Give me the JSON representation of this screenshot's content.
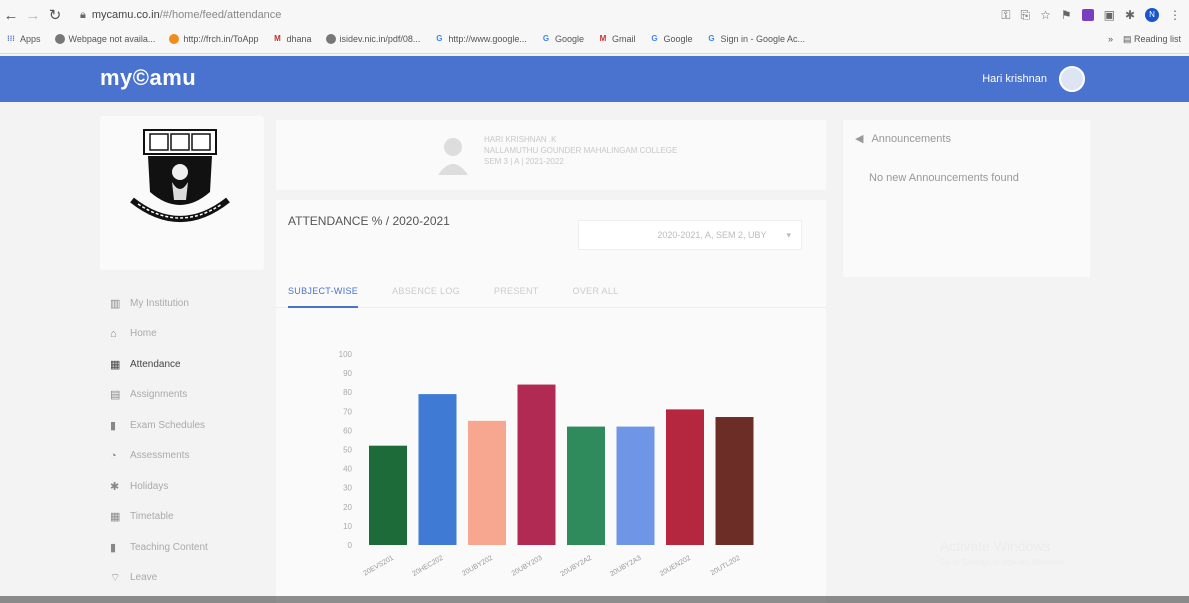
{
  "browser": {
    "url_host": "mycamu.co.in",
    "url_path": "/#/home/feed/attendance",
    "bookmarks": [
      {
        "label": "Apps",
        "icon": "apps-grid-icon"
      },
      {
        "label": "Webpage not availa...",
        "icon": "globe-icon"
      },
      {
        "label": "http://frch.in/ToApp",
        "icon": "orange-circle-icon"
      },
      {
        "label": "dhana",
        "icon": "gmail-icon"
      },
      {
        "label": "isidev.nic.in/pdf/08...",
        "icon": "globe-icon"
      },
      {
        "label": "http://www.google...",
        "icon": "google-icon"
      },
      {
        "label": "Google",
        "icon": "google-icon"
      },
      {
        "label": "Gmail",
        "icon": "gmail-icon"
      },
      {
        "label": "Google",
        "icon": "google-icon"
      },
      {
        "label": "Sign in - Google Ac...",
        "icon": "google-icon"
      }
    ],
    "more_bookmarks": "»",
    "reading_list": "Reading list",
    "profile_initial": "N"
  },
  "header": {
    "logo": "my©amu",
    "user_name": "Hari krishnan"
  },
  "sidebar": {
    "items": [
      {
        "label": "My Institution",
        "icon": "institution-icon",
        "glyph": "▥"
      },
      {
        "label": "Home",
        "icon": "home-icon",
        "glyph": "⌂"
      },
      {
        "label": "Attendance",
        "icon": "attendance-icon",
        "glyph": "▦",
        "active": true
      },
      {
        "label": "Assignments",
        "icon": "assignments-icon",
        "glyph": "▤"
      },
      {
        "label": "Exam Schedules",
        "icon": "exam-icon",
        "glyph": "▮"
      },
      {
        "label": "Assessments",
        "icon": "assessment-icon",
        "glyph": "◔"
      },
      {
        "label": "Holidays",
        "icon": "holiday-icon",
        "glyph": "✱"
      },
      {
        "label": "Timetable",
        "icon": "timetable-icon",
        "glyph": "▦"
      },
      {
        "label": "Teaching Content",
        "icon": "content-icon",
        "glyph": "▮"
      },
      {
        "label": "Leave",
        "icon": "leave-icon",
        "glyph": "⌔"
      }
    ]
  },
  "profile": {
    "name": "HARI KRISHNAN .K",
    "college": "NALLAMUTHU GOUNDER MAHALINGAM COLLEGE",
    "sem": "SEM 3 | A | 2021-2022"
  },
  "attendance": {
    "title": "ATTENDANCE % / 2020-2021",
    "select_value": "2020-2021, A, SEM 2, UBY",
    "tabs": [
      "SUBJECT-WISE",
      "ABSENCE LOG",
      "PRESENT",
      "OVER ALL"
    ]
  },
  "chart_data": {
    "type": "bar",
    "categories": [
      "20EVS201",
      "20HEC202",
      "20UBY202",
      "20UBY203",
      "20UBY2A2",
      "20UBY2A3",
      "20UEN202",
      "20UTL202"
    ],
    "values": [
      52,
      79,
      65,
      84,
      62,
      62,
      71,
      67
    ],
    "colors": [
      "#1e6b3a",
      "#3f7ad4",
      "#f7a78f",
      "#b02a54",
      "#2f8a5c",
      "#6f96e6",
      "#b5263f",
      "#6b2d26"
    ],
    "ylim": [
      0,
      100
    ],
    "yticks": [
      "0",
      "10",
      "20",
      "30",
      "40",
      "50",
      "60",
      "70",
      "80",
      "90",
      "100"
    ],
    "grid": false,
    "xlabel": "",
    "ylabel": "",
    "title": ""
  },
  "announcements": {
    "title": "Announcements",
    "empty_text": "No new Announcements found"
  },
  "watermark": {
    "title": "Activate Windows",
    "subtitle": "Go to Settings to activate Windows."
  }
}
